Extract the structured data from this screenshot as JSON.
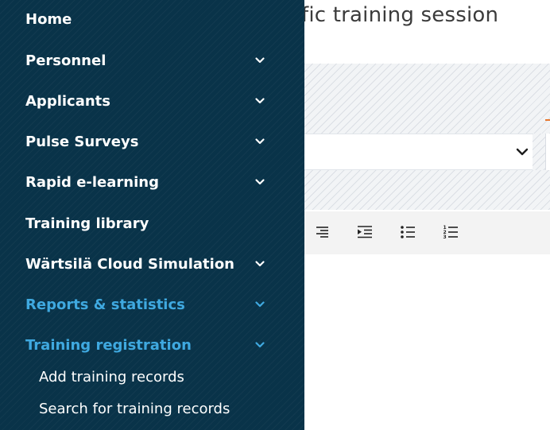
{
  "page": {
    "title": "fic training session"
  },
  "sidebar": {
    "items": [
      {
        "label": "Home",
        "has_submenu": false,
        "active": false
      },
      {
        "label": "Personnel",
        "has_submenu": true,
        "active": false
      },
      {
        "label": "Applicants",
        "has_submenu": true,
        "active": false
      },
      {
        "label": "Pulse Surveys",
        "has_submenu": true,
        "active": false
      },
      {
        "label": "Rapid e-learning",
        "has_submenu": true,
        "active": false
      },
      {
        "label": "Training library",
        "has_submenu": false,
        "active": false
      },
      {
        "label": "Wärtsilä Cloud Simulation",
        "has_submenu": true,
        "active": false
      },
      {
        "label": "Reports & statistics",
        "has_submenu": true,
        "active": true
      },
      {
        "label": "Training registration",
        "has_submenu": true,
        "active": true
      }
    ],
    "subitems": [
      {
        "label": "Add training records"
      },
      {
        "label": "Search for training records"
      }
    ]
  },
  "editor_toolbar": {
    "icons": [
      "align-right-icon",
      "indent-icon",
      "bulleted-list-icon",
      "numbered-list-icon"
    ]
  },
  "colors": {
    "sidebar_bg": "#093349",
    "nav_text": "#ffffff",
    "nav_active": "#3fa9e0",
    "toolbar_bg": "#f3f3f3",
    "accent_orange": "#e8772e"
  }
}
